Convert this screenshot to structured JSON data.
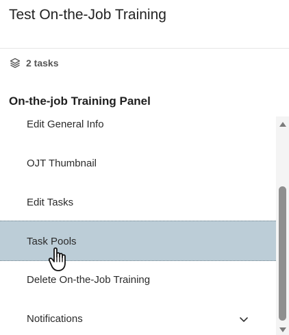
{
  "header": {
    "title": "Test On-the-Job Training"
  },
  "summary": {
    "task_count": "2 tasks",
    "icon": "layers-icon"
  },
  "panel": {
    "title": "On-the-job Training Panel",
    "items": [
      {
        "label": "Edit General Info",
        "active": false
      },
      {
        "label": "OJT Thumbnail",
        "active": false
      },
      {
        "label": "Edit Tasks",
        "active": false
      },
      {
        "label": "Task Pools",
        "active": true
      },
      {
        "label": "Delete On-the-Job Training",
        "active": false
      },
      {
        "label": "Notifications",
        "active": false,
        "icon": "chevron-down-icon"
      }
    ]
  },
  "colors": {
    "active_item_bg": "#bccdd7",
    "scroll_thumb": "#8f8f8f"
  }
}
